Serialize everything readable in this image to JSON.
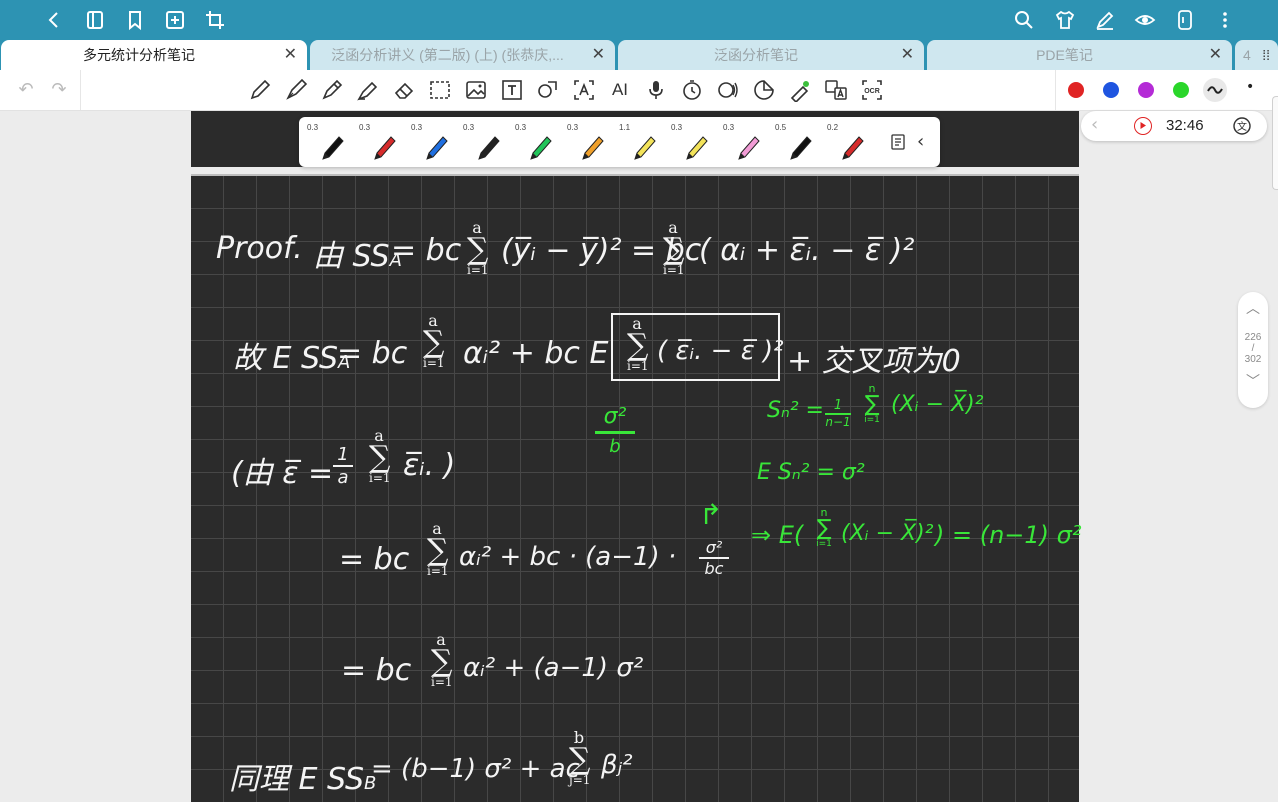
{
  "topbar": {
    "icons": [
      "back-arrow-icon",
      "notebook-icon",
      "bookmark-icon",
      "add-page-icon",
      "crop-icon",
      "search-icon",
      "shirt-icon",
      "edit-pen-icon",
      "eye-icon",
      "phone-device-icon",
      "more-vertical-icon"
    ]
  },
  "tabs": [
    {
      "label": "多元统计分析笔记",
      "active": true,
      "close": "✕"
    },
    {
      "label": "泛函分析讲义 (第二版) (上) (张恭庆,...",
      "active": false,
      "close": "✕"
    },
    {
      "label": "泛函分析笔记",
      "active": false,
      "close": "✕"
    },
    {
      "label": "PDE笔记",
      "active": false,
      "close": "✕"
    },
    {
      "label": "4",
      "active": false
    }
  ],
  "toolbar": {
    "colors": {
      "red": "#e02424",
      "blue": "#1f55e0",
      "purple": "#b42bd6",
      "green": "#2ad62a"
    },
    "more": "•"
  },
  "penbar": {
    "pens": [
      {
        "width": "0.3",
        "color": "#111111"
      },
      {
        "width": "0.3",
        "color": "#d62b2b"
      },
      {
        "width": "0.3",
        "color": "#1f6fe0"
      },
      {
        "width": "0.3",
        "color": "#222222"
      },
      {
        "width": "0.3",
        "color": "#21c45a"
      },
      {
        "width": "0.3",
        "color": "#f0a02a"
      },
      {
        "width": "1.1",
        "color": "#f3e35a"
      },
      {
        "width": "0.3",
        "color": "#f3e35a"
      },
      {
        "width": "0.3",
        "color": "#f29cd6"
      },
      {
        "width": "0.5",
        "color": "#111111"
      },
      {
        "width": "0.2",
        "color": "#d62b2b"
      }
    ],
    "collapse": "‹"
  },
  "audio": {
    "time": "32:46"
  },
  "pager": {
    "current": "226",
    "sep": "/",
    "total": "302"
  },
  "note": {
    "l1_proof": "Proof.",
    "l1_you": "由 SS",
    "l1_sub": "A",
    "l1_expr": "= bc",
    "l1_sum_top": "a",
    "l1_sum_bot": "i=1",
    "l1_term": "(y̅ᵢ − y̅)²  = bc",
    "l1_sum2_top": "a",
    "l1_sum2_bot": "i=1",
    "l1_term2": "( αᵢ + ε̅ᵢ. − ε̅ )²",
    "l2_lead": "故 E SS",
    "l2_sub": "A",
    "l2_eq": "=  bc",
    "l2_sum_top": "a",
    "l2_sum_bot": "i=1",
    "l2_alpha": "αᵢ²  +  bc E",
    "l2_inner_top": "a",
    "l2_inner_bot": "i=1",
    "l2_inner": "( ε̅ᵢ. − ε̅ )²",
    "l2_tail": "+   交叉项为0",
    "frac_num": "σ²",
    "frac_den": "b",
    "l3_lead": "(由  ε̅ =",
    "l3_frac_num": "1",
    "l3_frac_den": "a",
    "l3_sum_top": "a",
    "l3_sum_bot": "i=1",
    "l3_tail": "ε̅ᵢ. )",
    "l4_eq": "=  bc",
    "l4_sum_top": "a",
    "l4_sum_bot": "i=1",
    "l4_mid": "αᵢ²   +    bc · (a−1) ·",
    "l4_frac_num": "σ²",
    "l4_frac_den": "bc",
    "l5_eq": "=  bc",
    "l5_sum_top": "a",
    "l5_sum_bot": "i=1",
    "l5_tail": "αᵢ²   +   (a−1) σ²",
    "l6_lead": "同理  E SS",
    "l6_sub": "B",
    "l6_eq": "= (b−1) σ² + ac",
    "l6_sum_top": "b",
    "l6_sum_bot": "j=1",
    "l6_tail": "βⱼ²",
    "g1_lhs": "Sₙ² =",
    "g1_frac_num": "1",
    "g1_frac_den": "n−1",
    "g1_sum_top": "n",
    "g1_sum_bot": "i=1",
    "g1_tail": "(Xᵢ − X̅)²",
    "g2": "E Sₙ² = σ²",
    "g3_lead": "⇒ E(",
    "g3_sum_top": "n",
    "g3_sum_bot": "i=1",
    "g3_mid": "(Xᵢ − X̅)²",
    "g3_tail": ") = (n−1) σ²",
    "arrow": "↱"
  }
}
